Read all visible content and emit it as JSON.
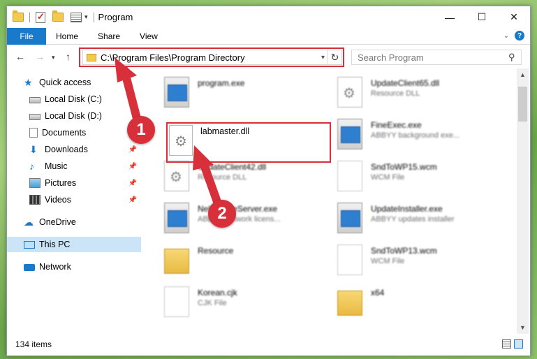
{
  "window": {
    "title": "Program",
    "controls": {
      "minimize": "—",
      "maximize": "☐",
      "close": "✕"
    }
  },
  "ribbon": {
    "file": "File",
    "tabs": [
      "Home",
      "Share",
      "View"
    ],
    "help": "?"
  },
  "address": {
    "path": "C:\\Program Files\\Program Directory",
    "search_placeholder": "Search Program"
  },
  "sidebar": {
    "items": [
      {
        "label": "Quick access",
        "icon": "star-icon",
        "pinned": false
      },
      {
        "label": "Local Disk (C:)",
        "icon": "drive-icon",
        "pinned": false
      },
      {
        "label": "Local Disk (D:)",
        "icon": "drive-icon",
        "pinned": false
      },
      {
        "label": "Documents",
        "icon": "document-icon",
        "pinned": false
      },
      {
        "label": "Downloads",
        "icon": "download-icon",
        "pinned": true
      },
      {
        "label": "Music",
        "icon": "music-icon",
        "pinned": true
      },
      {
        "label": "Pictures",
        "icon": "pictures-icon",
        "pinned": true
      },
      {
        "label": "Videos",
        "icon": "videos-icon",
        "pinned": true
      },
      {
        "label": "OneDrive",
        "icon": "cloud-icon",
        "pinned": false
      },
      {
        "label": "This PC",
        "icon": "computer-icon",
        "pinned": false,
        "selected": true
      },
      {
        "label": "Network",
        "icon": "network-icon",
        "pinned": false
      }
    ]
  },
  "files": {
    "highlighted": {
      "name": "labmaster.dll",
      "icon": "dll-gear-icon"
    },
    "left": [
      {
        "name": "program.exe",
        "type": "",
        "icon": "exe-icon"
      },
      {
        "name": "UpdateClient42.dll",
        "type": "Resource DLL",
        "icon": "dll-gear-icon"
      },
      {
        "name": "NeLicenseServer.exe",
        "type": "ABBYY network licens...",
        "icon": "exe-icon"
      },
      {
        "name": "Resource",
        "type": "",
        "icon": "folder-icon"
      },
      {
        "name": "Korean.cjk",
        "type": "CJK File",
        "icon": "document-icon"
      }
    ],
    "right": [
      {
        "name": "UpdateClient65.dll",
        "type": "Resource DLL",
        "icon": "dll-gear-icon"
      },
      {
        "name": "FineExec.exe",
        "type": "ABBYY background exe...",
        "icon": "exe-icon"
      },
      {
        "name": "SndToWP15.wcm",
        "type": "WCM File",
        "icon": "document-icon"
      },
      {
        "name": "UpdateInstaller.exe",
        "type": "ABBYY updates installer",
        "icon": "exe-icon"
      },
      {
        "name": "SndToWP13.wcm",
        "type": "WCM File",
        "icon": "document-icon"
      },
      {
        "name": "x64",
        "type": "",
        "icon": "folder-icon"
      }
    ]
  },
  "status": {
    "item_count": "134 items"
  },
  "annotations": {
    "step1": "1",
    "step2": "2",
    "color": "#d8303a"
  }
}
